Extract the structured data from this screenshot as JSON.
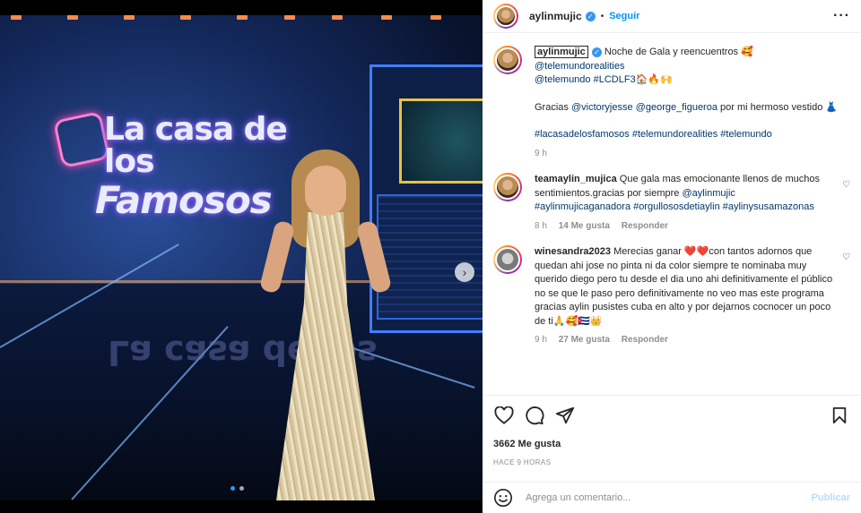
{
  "post": {
    "username": "aylinmujic",
    "follow_label": "Seguir",
    "more_label": "···"
  },
  "photo": {
    "logo_line1": "La casa de los",
    "logo_line2": "Famosos",
    "logo_reflection": "La casa de los",
    "next_glyph": "›",
    "carousel_current": 1,
    "carousel_total": 2
  },
  "caption": {
    "username": "aylinmujic",
    "text1": "Noche de Gala y reencuentros 🥰",
    "mention1": "@telemundorealities",
    "mention2": "@telemundo",
    "hashtag1": "#LCDLF3",
    "emoji1": "🏠🔥🙌",
    "thanks_prefix": "Gracias",
    "mention3": "@victoryjesse",
    "mention4": "@george_figueroa",
    "thanks_suffix": "por mi hermoso vestido 👗",
    "hashtags": "#lacasadelosfamosos #telemundorealities #telemundo",
    "time": "9 h"
  },
  "comments": [
    {
      "username": "teamaylin_mujica",
      "text": "Que gala mas emocionante llenos de muchos sentimientos.gracias por siempre",
      "mention": "@aylinmujic",
      "tags": "#aylinmujicaganadora #orgullososdetiaylin #aylinysusamazonas",
      "time": "8 h",
      "likes": "14 Me gusta",
      "reply": "Responder"
    },
    {
      "username": "winesandra2023",
      "text": "Merecias ganar ❤️❤️con tantos adornos que quedan ahi jose no pinta ni da color siempre te nominaba muy querido diego pero tu desde el dia uno ahi definitivamente el público no se que le paso pero definitivamente no veo mas este programa gracias aylin pusistes cuba en alto y por dejarnos cocnocer un poco de ti🙏🥰🇨🇺👑",
      "time": "9 h",
      "likes": "27 Me gusta",
      "reply": "Responder"
    }
  ],
  "footer": {
    "likes": "3662 Me gusta",
    "time": "HACE 9 HORAS",
    "comment_placeholder": "Agrega un comentario...",
    "publish_label": "Publicar"
  }
}
